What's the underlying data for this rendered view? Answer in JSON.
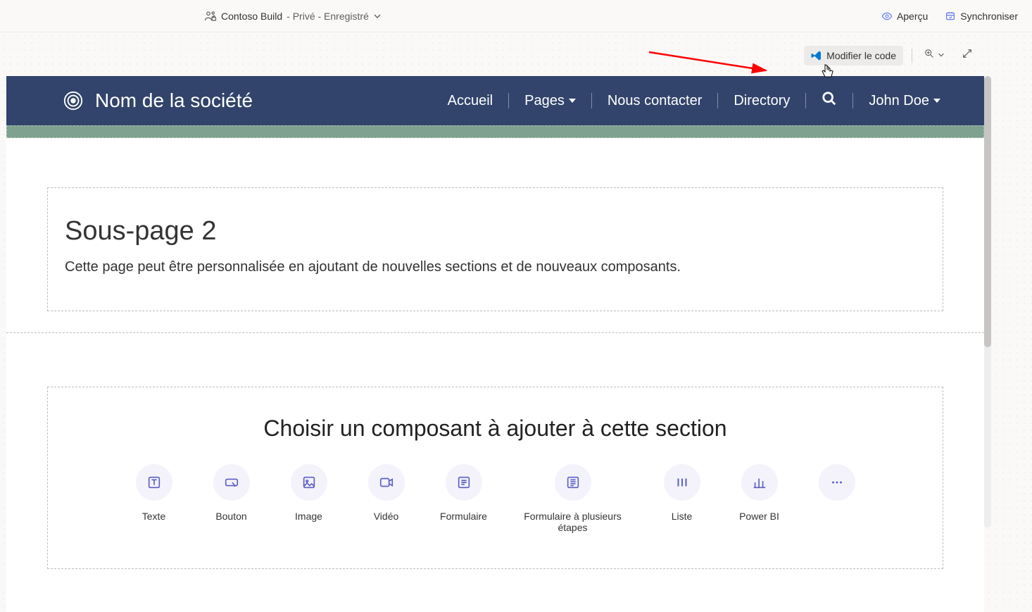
{
  "topbar": {
    "title_primary": "Contoso Build",
    "title_secondary": "- Privé - Enregistré",
    "preview_label": "Aperçu",
    "sync_label": "Synchroniser"
  },
  "editor_toolbar": {
    "edit_code_label": "Modifier le code"
  },
  "site": {
    "company_name": "Nom de la société",
    "nav": {
      "home": "Accueil",
      "pages": "Pages",
      "contact": "Nous contacter",
      "directory": "Directory",
      "user": "John Doe"
    },
    "page": {
      "heading": "Sous-page 2",
      "description": "Cette page peut être personnalisée en ajoutant de nouvelles sections et de nouveaux composants."
    },
    "component_picker": {
      "heading": "Choisir un composant à ajouter à cette section",
      "items": [
        {
          "label": "Texte"
        },
        {
          "label": "Bouton"
        },
        {
          "label": "Image"
        },
        {
          "label": "Vidéo"
        },
        {
          "label": "Formulaire"
        },
        {
          "label": "Formulaire à plusieurs étapes"
        },
        {
          "label": "Liste"
        },
        {
          "label": "Power BI"
        },
        {
          "label": "···"
        }
      ]
    }
  }
}
